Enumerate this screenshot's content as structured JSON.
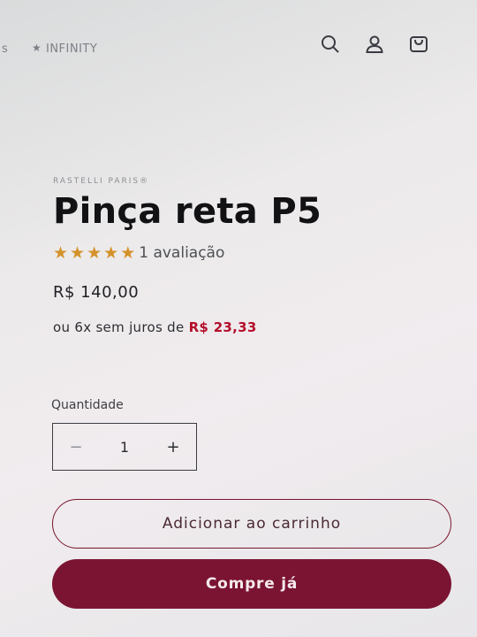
{
  "header": {
    "marquee_fragment": "s",
    "marquee_star": "★",
    "marquee_text": "INFINITY"
  },
  "icons": {
    "search": "search-icon",
    "account": "user-icon",
    "cart": "cart-icon"
  },
  "product": {
    "vendor": "RASTELLI PARIS®",
    "title": "Pinça reta P5",
    "rating_value": 5,
    "stars": [
      "★",
      "★",
      "★",
      "★",
      "★"
    ],
    "review_count": "1 avaliação",
    "price": "R$ 140,00",
    "installments_prefix": "ou 6x sem juros de",
    "installments_amount": "R$ 23,33"
  },
  "quantity": {
    "label": "Quantidade",
    "minus": "−",
    "value": "1",
    "plus": "+"
  },
  "actions": {
    "add_to_cart": "Adicionar ao carrinho",
    "buy_now": "Compre já"
  },
  "colors": {
    "accent": "#7b1433",
    "price_highlight": "#b40f2a",
    "star": "#d4922a"
  }
}
